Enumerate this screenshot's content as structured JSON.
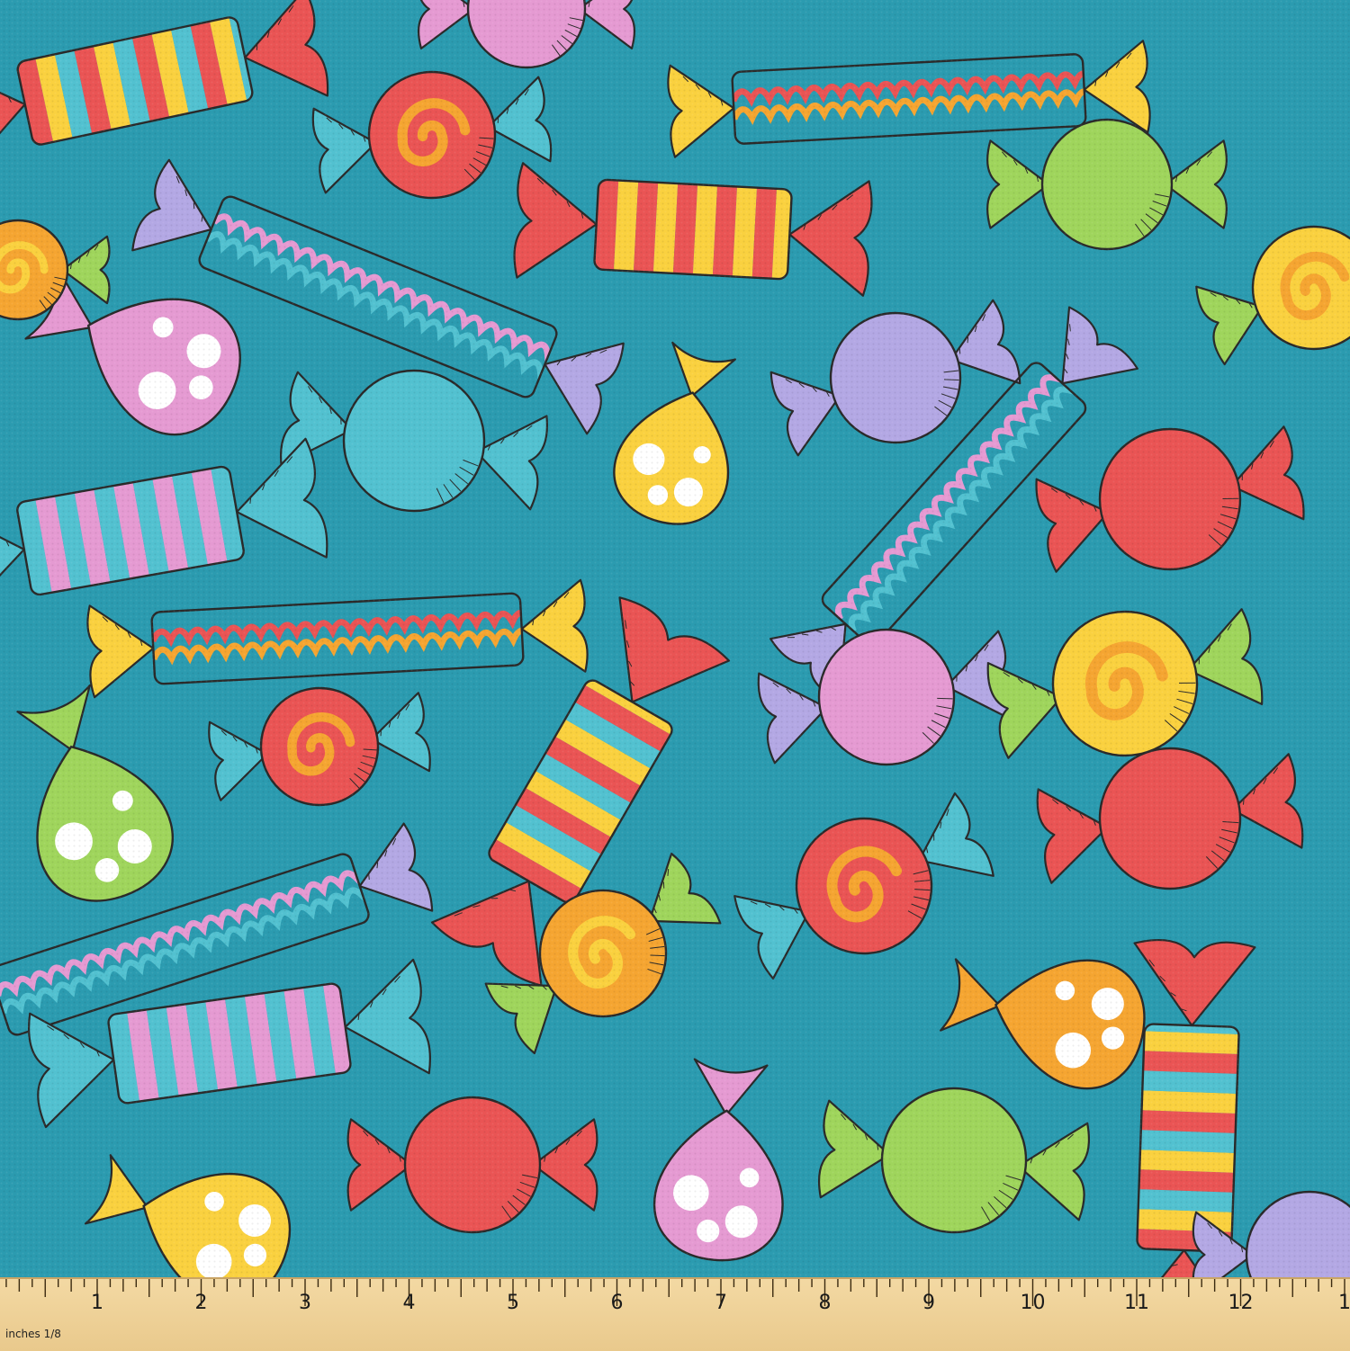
{
  "scene": {
    "subject": "candy-print-fabric",
    "background_color": "#2b9bb0",
    "palette": {
      "red": "#ea5454",
      "yellow": "#fad13f",
      "orange": "#f5a531",
      "pink": "#e59ad2",
      "lavender": "#b3a8e4",
      "green": "#9fd55c",
      "aqua": "#52c1d0",
      "outline": "#2a2a2a",
      "dot": "#ffffff"
    }
  },
  "ruler": {
    "unit_label": "inches 1/8",
    "numbers": [
      "1",
      "2",
      "3",
      "4",
      "5",
      "6",
      "7",
      "8",
      "9",
      "10",
      "11",
      "12",
      "1"
    ]
  }
}
